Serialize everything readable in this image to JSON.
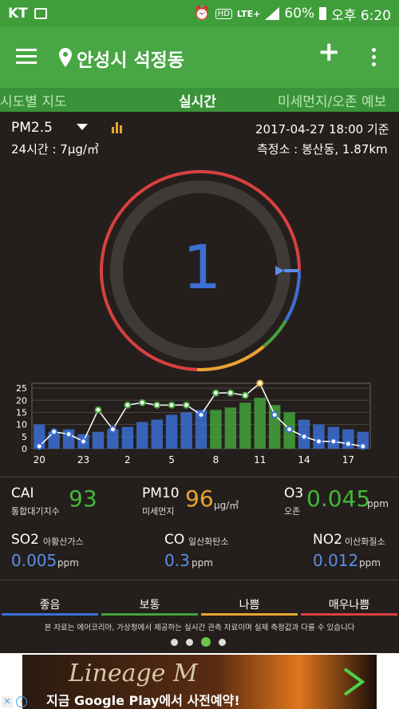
{
  "status": {
    "carrier": "KT",
    "battery": "60%",
    "time": "오후 6:20",
    "network": "LTE+",
    "hd": "HD"
  },
  "appbar": {
    "location": "안성시 석정동"
  },
  "tabs": [
    {
      "label": "시도별 지도"
    },
    {
      "label": "실시간"
    },
    {
      "label": "미세먼지/오존 예보"
    }
  ],
  "header": {
    "pollutant": "PM2.5",
    "avg24": "24시간 : 7μg/㎥",
    "date": "2017-04-27  18:00 기준",
    "station": "측정소 : 봉산동, 1.87km"
  },
  "gauge": {
    "value": "1",
    "level": 0.02
  },
  "colors": {
    "good": "#3b6fd4",
    "normal": "#43a33a",
    "bad": "#e8a531",
    "very_bad": "#d94040"
  },
  "chart_data": {
    "type": "bar",
    "x": [
      20,
      21,
      22,
      23,
      0,
      1,
      2,
      3,
      4,
      5,
      6,
      7,
      8,
      9,
      10,
      11,
      12,
      13,
      14,
      15,
      16,
      17,
      18
    ],
    "x_tick_labels": [
      "20",
      "23",
      "2",
      "5",
      "8",
      "11",
      "14",
      "17"
    ],
    "y_ticks": [
      "0",
      "5",
      "10",
      "15",
      "20",
      "25"
    ],
    "ylim": [
      0,
      27
    ],
    "series": [
      {
        "values": [
          10,
          7,
          8,
          6,
          7,
          8,
          9,
          11,
          12,
          14,
          15,
          16,
          16,
          17,
          19,
          21,
          18,
          15,
          12,
          10,
          9,
          8,
          7
        ]
      },
      {
        "values": [
          1,
          7,
          6,
          3,
          16,
          8,
          18,
          19,
          18,
          18,
          18,
          14,
          23,
          23,
          22,
          27,
          14,
          8,
          5,
          3,
          3,
          2,
          1
        ]
      }
    ]
  },
  "metrics": {
    "cai": {
      "name": "CAI",
      "sub": "통합대기지수",
      "value": "93"
    },
    "pm10": {
      "name": "PM10",
      "sub": "미세먼지",
      "value": "96",
      "unit": "μg/㎥"
    },
    "o3": {
      "name": "O3",
      "sub": "오존",
      "value": "0.045",
      "unit": "ppm"
    },
    "so2": {
      "name": "SO2",
      "sub": "아황산가스",
      "value": "0.005",
      "unit": "ppm"
    },
    "co": {
      "name": "CO",
      "sub": "일산화탄소",
      "value": "0.3",
      "unit": "ppm"
    },
    "no2": {
      "name": "NO2",
      "sub": "이산화질소",
      "value": "0.012",
      "unit": "ppm"
    }
  },
  "legend": [
    {
      "label": "좋음"
    },
    {
      "label": "보통"
    },
    {
      "label": "나쁨"
    },
    {
      "label": "매우나쁨"
    }
  ],
  "notice": "본 자료는 에어코리아, 가상청에서 제공하는 실시간 관측 자료이며 실제 측정값과 다를 수 있습니다",
  "ad": {
    "title": "Lineage M",
    "text": "지금 Google Play에서 사전예약!"
  }
}
